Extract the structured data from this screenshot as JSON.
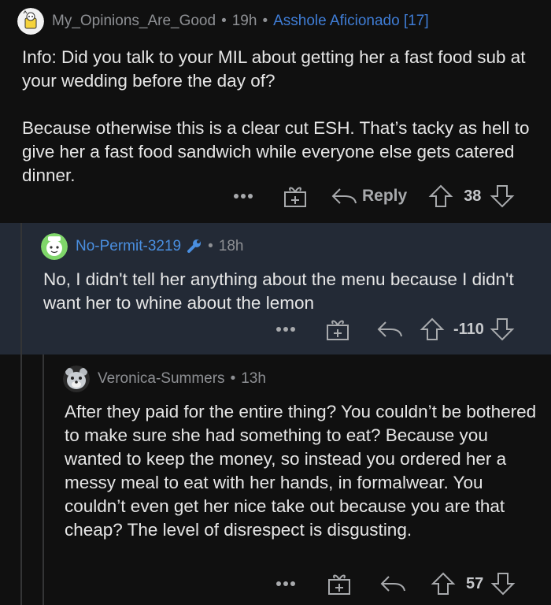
{
  "comments": [
    {
      "username": "My_Opinions_Are_Good",
      "separator": "•",
      "time": "19h",
      "flair": "Asshole Aficionado [17]",
      "paragraphs": [
        "Info: Did you talk to your MIL about getting her a fast food sub at your wedding before the day of?",
        "Because otherwise this is a clear cut ESH. That’s tacky as hell to give her a fast food sandwich while everyone else gets catered dinner."
      ],
      "reply_label": "Reply",
      "score": "38"
    },
    {
      "username": "No-Permit-3219",
      "separator": "•",
      "time": "18h",
      "body": "No, I didn't tell her anything about the menu because I didn't want her to whine about the lemon",
      "score": "-110",
      "highlight_color": "#232a36"
    },
    {
      "username": "Veronica-Summers",
      "separator": "•",
      "time": "13h",
      "body": "After they paid for the entire thing? You couldn’t be bothered to make sure she had something to eat? Because you wanted to keep the money, so instead you ordered her a messy meal to eat with her hands, in formalwear. You couldn’t even get her nice take out because you are that cheap? The level of disrespect is disgusting.",
      "score": "57"
    }
  ],
  "icons": {
    "more": "more-options-icon",
    "award": "gift-award-icon",
    "reply": "reply-arrow-icon",
    "upvote": "upvote-arrow-icon",
    "downvote": "downvote-arrow-icon",
    "op_badge": "wrench-op-icon"
  },
  "colors": {
    "background": "#101010",
    "highlight": "#232a36",
    "username_link": "#4a8fe0",
    "flair": "#3f7dd6"
  }
}
